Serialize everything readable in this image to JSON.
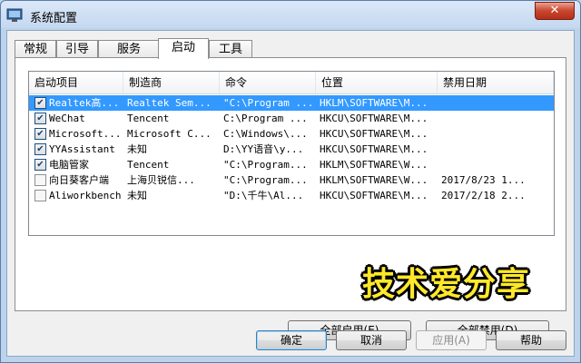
{
  "window": {
    "title": "系统配置",
    "close_label": "✕"
  },
  "tabs": [
    "常规",
    "引导",
    "服务",
    "启动",
    "工具"
  ],
  "active_tab": "启动",
  "startup_table": {
    "columns": [
      "启动项目",
      "制造商",
      "命令",
      "位置",
      "禁用日期"
    ],
    "rows": [
      {
        "checked": true,
        "item": "Realtek高...",
        "maker": "Realtek Sem...",
        "command": "\"C:\\Program ...",
        "location": "HKLM\\SOFTWARE\\M...",
        "disabled": "",
        "selected": true
      },
      {
        "checked": true,
        "item": "WeChat",
        "maker": "Tencent",
        "command": "C:\\Program ...",
        "location": "HKCU\\SOFTWARE\\M...",
        "disabled": ""
      },
      {
        "checked": true,
        "item": "Microsoft...",
        "maker": "Microsoft C...",
        "command": "C:\\Windows\\...",
        "location": "HKCU\\SOFTWARE\\M...",
        "disabled": ""
      },
      {
        "checked": true,
        "item": "YYAssistant",
        "maker": "未知",
        "command": "D:\\YY语音\\y...",
        "location": "HKCU\\SOFTWARE\\M...",
        "disabled": ""
      },
      {
        "checked": true,
        "item": "电脑管家",
        "maker": "Tencent",
        "command": "\"C:\\Program...",
        "location": "HKLM\\SOFTWARE\\W...",
        "disabled": ""
      },
      {
        "checked": false,
        "item": "向日葵客户端",
        "maker": "上海贝锐信...",
        "command": "\"C:\\Program...",
        "location": "HKLM\\SOFTWARE\\W...",
        "disabled": "2017/8/23 1..."
      },
      {
        "checked": false,
        "item": "Aliworkbench",
        "maker": "未知",
        "command": "\"D:\\千牛\\Al...",
        "location": "HKCU\\SOFTWARE\\M...",
        "disabled": "2017/2/18 2..."
      }
    ]
  },
  "buttons": {
    "enable_all": "全部启用(E)",
    "disable_all": "全部禁用(D)",
    "ok": "确定",
    "cancel": "取消",
    "apply": "应用(A)",
    "help": "帮助"
  },
  "watermark": "技术爱分享"
}
